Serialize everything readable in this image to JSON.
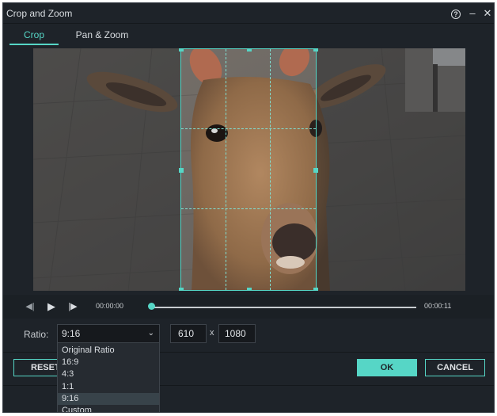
{
  "window": {
    "title": "Crop and Zoom"
  },
  "tabs": [
    {
      "label": "Crop"
    },
    {
      "label": "Pan & Zoom"
    }
  ],
  "player": {
    "current_time": "00:00:00",
    "end_time": "00:00:11",
    "progress": 0.0
  },
  "ratio": {
    "label": "Ratio:",
    "selected": "9:16",
    "width": "610",
    "times": "x",
    "height": "1080",
    "options": [
      "Original Ratio",
      "16:9",
      "4:3",
      "1:1",
      "9:16",
      "Custom"
    ]
  },
  "buttons": {
    "reset": "RESET",
    "ok": "OK",
    "cancel": "CANCEL"
  },
  "colors": {
    "accent": "#56d6c6",
    "background": "#1e2329"
  },
  "icons": {
    "help": "help-icon",
    "minimize": "minimize-icon",
    "close": "close-icon",
    "prev": "prev-frame-icon",
    "play": "play-icon",
    "next": "next-frame-icon",
    "dropdown": "chevron-down-icon"
  }
}
